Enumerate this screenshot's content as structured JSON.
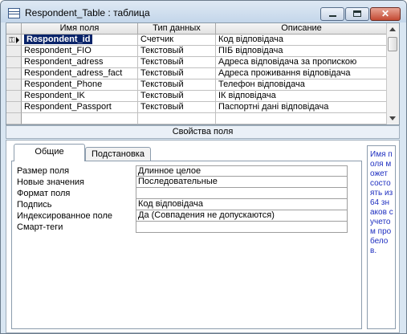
{
  "window": {
    "title": "Respondent_Table : таблица",
    "close_glyph": "✕"
  },
  "grid": {
    "headers": [
      "Имя поля",
      "Тип данных",
      "Описание"
    ],
    "rows": [
      {
        "name": "Respondent_id",
        "type": "Счетчик",
        "description": "Код відповідача",
        "primary_key": true,
        "selected": true
      },
      {
        "name": "Respondent_FIO",
        "type": "Текстовый",
        "description": "ПІБ відповідача"
      },
      {
        "name": "Respondent_adress",
        "type": "Текстовый",
        "description": "Адреса відповідача за пропискою"
      },
      {
        "name": "Respondent_adress_fact",
        "type": "Текстовый",
        "description": "Адреса проживання відповідача"
      },
      {
        "name": "Respondent_Phone",
        "type": "Текстовый",
        "description": "Телефон відповідача"
      },
      {
        "name": "Respondent_IK",
        "type": "Текстовый",
        "description": "ІК відповідача"
      },
      {
        "name": "Respondent_Passport",
        "type": "Текстовый",
        "description": "Паспортні дані відповідача"
      }
    ],
    "key_glyph": "⚿"
  },
  "properties": {
    "header": "Свойства поля",
    "tabs": [
      "Общие",
      "Подстановка"
    ],
    "active_tab": "Общие",
    "rows": [
      {
        "label": "Размер поля",
        "value": "Длинное целое"
      },
      {
        "label": "Новые значения",
        "value": "Последовательные"
      },
      {
        "label": "Формат поля",
        "value": ""
      },
      {
        "label": "Подпись",
        "value": "Код відповідача"
      },
      {
        "label": "Индексированное поле",
        "value": "Да (Совпадения не допускаются)"
      },
      {
        "label": "Смарт-теги",
        "value": ""
      }
    ],
    "help_text": "Имя поля может состоять из 64 знаков с учетом пробелов."
  },
  "colors": {
    "selection": "#0a246a",
    "window_frame": "#d9e6f2",
    "help_text": "#1f2fc0"
  }
}
